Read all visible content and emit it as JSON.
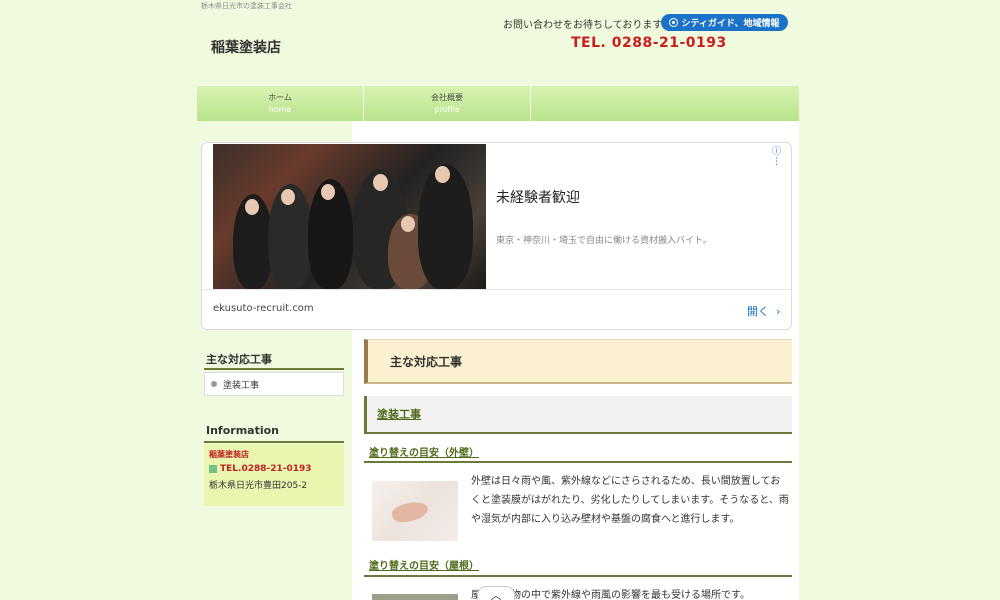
{
  "header": {
    "tagline": "栃木県日光市の塗装工事会社",
    "site_title": "稲葉塗装店",
    "contact_text": "お問い合わせをお待ちしております",
    "city_badge": "シティガイド、地域情報",
    "tel": "TEL. 0288-21-0193"
  },
  "nav": {
    "items": [
      {
        "jp": "ホーム",
        "en": "home"
      },
      {
        "jp": "会社概要",
        "en": "profile"
      }
    ]
  },
  "ad": {
    "title": "未経験者歓迎",
    "description": "東京・神奈川・埼玉で自由に働ける資材搬入バイト。",
    "url": "ekusuto-recruit.com",
    "open_label": "開く",
    "open_icon": "chevron-right-icon",
    "choices_icon": "info-icon"
  },
  "sidebar": {
    "services_heading": "主な対応工事",
    "services": [
      {
        "label": "塗装工事"
      }
    ],
    "info_heading": "Information",
    "info": {
      "name": "稲葉塗装店",
      "tel": "TEL.0288-21-0193",
      "address": "栃木県日光市豊田205-2"
    }
  },
  "main": {
    "page_heading": "主な対応工事",
    "section_heading": "塗装工事",
    "sub1": {
      "heading": "塗り替えの目安（外壁）",
      "text": "外壁は日々雨や風、紫外線などにさらされるため、長い間放置しておくと塗装膜がはがれたり、劣化したりしてしまいます。そうなると、雨や湿気が内部に入り込み壁材や基盤の腐食へと進行します。"
    },
    "sub2": {
      "heading": "塗り替えの目安（屋根）",
      "text": "屋根は建物の中で紫外線や雨風の影響を最も受ける場所です。"
    }
  },
  "scroll_top_icon": "chevron-up-icon",
  "colors": {
    "background": "#f0fadf",
    "nav": "#c4e89a",
    "tel": "#cc1d1d",
    "badge": "#1a73c8",
    "heading_accent": "#6b7a3a"
  }
}
